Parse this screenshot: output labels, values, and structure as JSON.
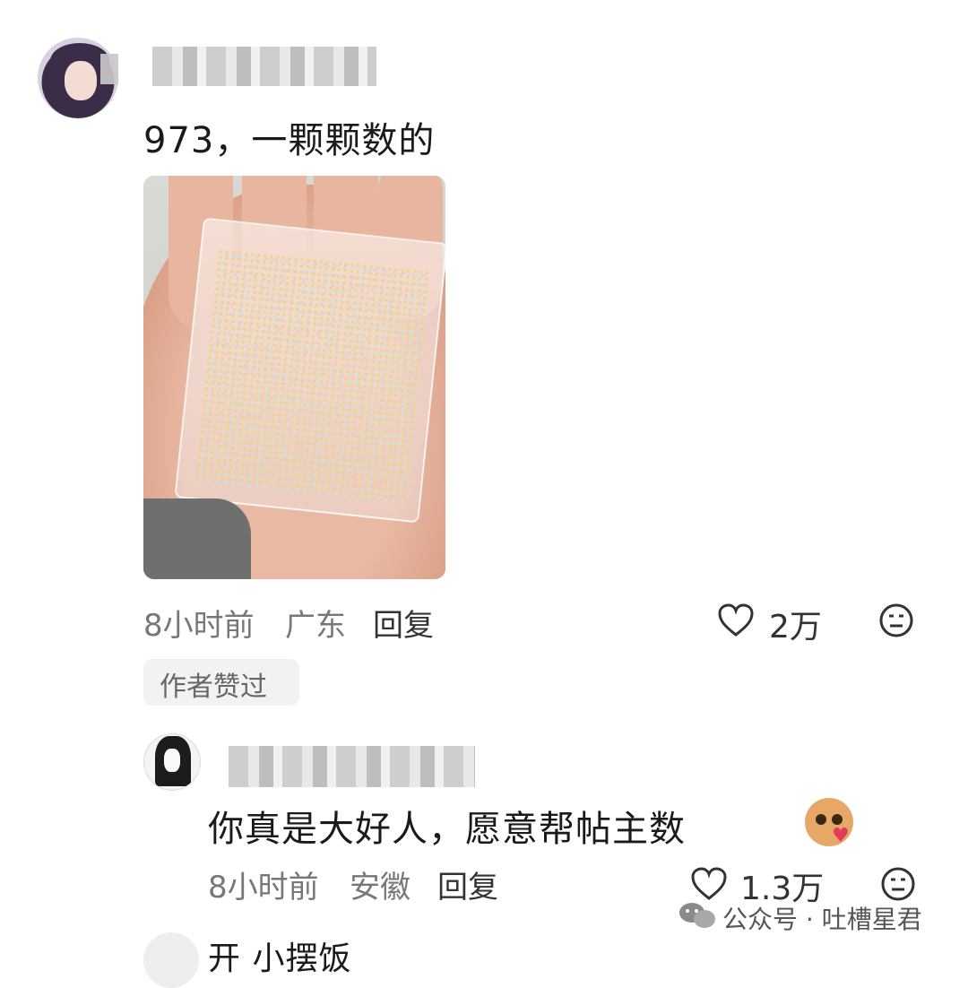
{
  "comment": {
    "text": "973，一颗颗数的",
    "time": "8小时前",
    "location": "广东",
    "reply_label": "回复",
    "like_count": "2万",
    "author_liked_tag": "作者赞过"
  },
  "reply_comment": {
    "text": "你真是大好人，愿意帮帖主数",
    "time": "8小时前",
    "location": "安徽",
    "reply_label": "回复",
    "like_count": "1.3万"
  },
  "watermark": {
    "text": "公众号 · 吐槽星君"
  },
  "next_comment_partial": {
    "text": "开 小摆饭"
  },
  "icons": [
    "heart-outline-icon",
    "dislike-face-icon",
    "wechat-icon",
    "emoji-cat-icon"
  ]
}
